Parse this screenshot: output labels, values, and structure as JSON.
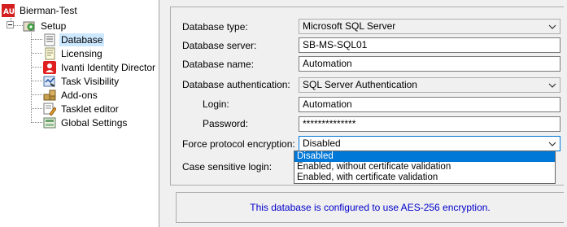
{
  "tree": {
    "root_label": "Bierman-Test",
    "setup_label": "Setup",
    "items": [
      {
        "label": "Database",
        "icon": "database-icon",
        "selected": true
      },
      {
        "label": "Licensing",
        "icon": "licensing-icon"
      },
      {
        "label": "Ivanti Identity Director",
        "icon": "identity-director-icon"
      },
      {
        "label": "Task Visibility",
        "icon": "task-visibility-icon"
      },
      {
        "label": "Add-ons",
        "icon": "add-ons-icon"
      },
      {
        "label": "Tasklet editor",
        "icon": "tasklet-editor-icon"
      },
      {
        "label": "Global Settings",
        "icon": "global-settings-icon"
      }
    ]
  },
  "form": {
    "db_type_label": "Database type:",
    "db_type_value": "Microsoft SQL Server",
    "db_server_label": "Database server:",
    "db_server_value": "SB-MS-SQL01",
    "db_name_label": "Database name:",
    "db_name_value": "Automation",
    "db_auth_label": "Database authentication:",
    "db_auth_value": "SQL Server Authentication",
    "login_label": "Login:",
    "login_value": "Automation",
    "password_label": "Password:",
    "password_value": "**************",
    "encryption_label": "Force protocol encryption:",
    "encryption_value": "Disabled",
    "case_label": "Case sensitive login:"
  },
  "dropdown": {
    "options": [
      "Disabled",
      "Enabled, without certificate validation",
      "Enabled, with certificate validation"
    ],
    "selected_index": 0
  },
  "info": {
    "message": "This database is configured to use AES-256 encryption."
  },
  "colors": {
    "selection": "#0078d7",
    "tree_selection": "#cce8ff",
    "info_text": "#0000cc"
  }
}
